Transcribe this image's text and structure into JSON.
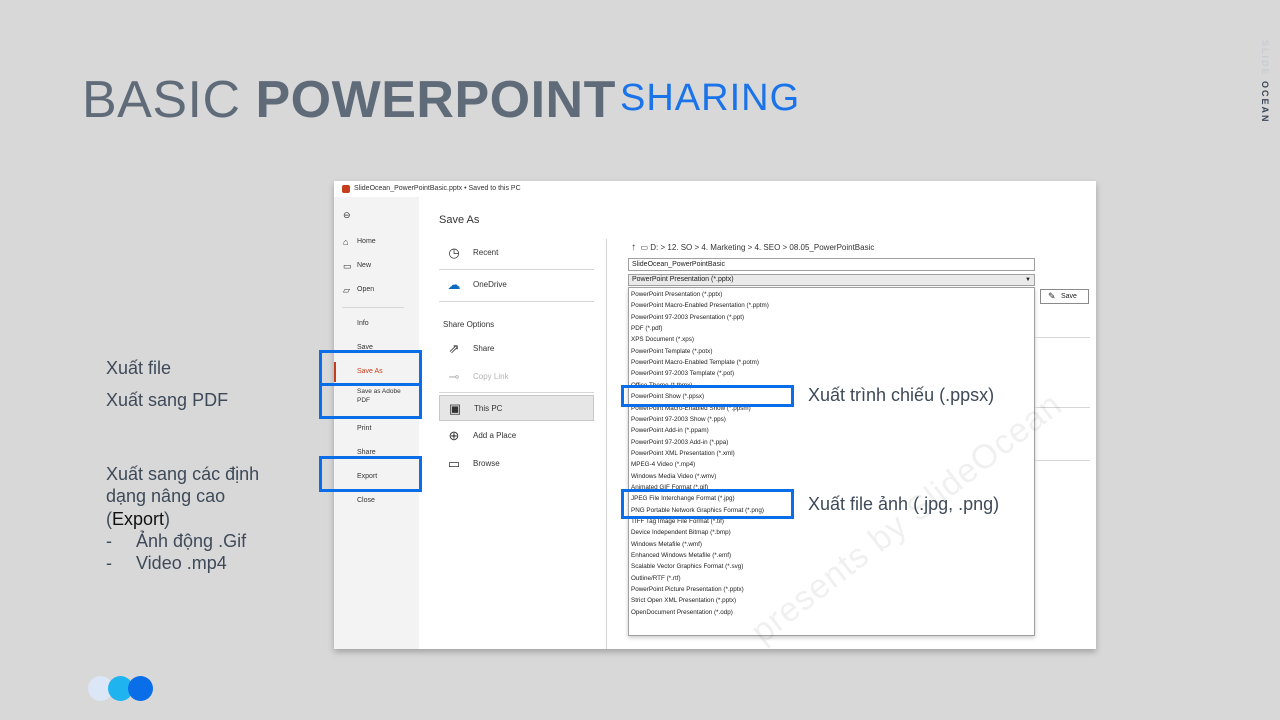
{
  "slide": {
    "title_light": "BASIC ",
    "title_bold": "POWERPOINT",
    "subtitle": "SHARING",
    "brand_line1": "SLIDE",
    "brand_line2": "OCEAN"
  },
  "left_notes": {
    "export_file": "Xuất file",
    "export_pdf": "Xuất sang PDF",
    "advanced_line1": "Xuất sang các định",
    "advanced_line2": "dạng nâng cao",
    "advanced_open": "(",
    "advanced_export": "Export",
    "advanced_close": ")",
    "bullet_dash": "-",
    "bullet1": "Ảnh động .Gif",
    "bullet2": "Video .mp4"
  },
  "window": {
    "title": "SlideOcean_PowerPointBasic.pptx • Saved to this PC"
  },
  "backstage_nav": {
    "home": "Home",
    "new": "New",
    "open": "Open",
    "info": "Info",
    "save": "Save",
    "save_as": "Save As",
    "save_as_pdf": "Save as Adobe PDF",
    "print": "Print",
    "share": "Share",
    "export": "Export",
    "close": "Close"
  },
  "save_as": {
    "title": "Save As",
    "recent": "Recent",
    "onedrive": "OneDrive",
    "share_options": "Share Options",
    "share": "Share",
    "copy_link": "Copy Link",
    "this_pc": "This PC",
    "add_place": "Add a Place",
    "browse": "Browse",
    "breadcrumb": "D: > 12. SO > 4. Marketing > 4. SEO > 08.05_PowerPointBasic",
    "file_name": "SlideOcean_PowerPointBasic",
    "file_type": "PowerPoint Presentation (*.pptx)",
    "save_button": "Save"
  },
  "file_types": [
    "PowerPoint Presentation (*.pptx)",
    "PowerPoint Macro-Enabled Presentation (*.pptm)",
    "PowerPoint 97-2003 Presentation (*.ppt)",
    "PDF (*.pdf)",
    "XPS Document (*.xps)",
    "PowerPoint Template (*.potx)",
    "PowerPoint Macro-Enabled Template (*.potm)",
    "PowerPoint 97-2003 Template (*.pot)",
    "Office Theme (*.thmx)",
    "PowerPoint Show (*.ppsx)",
    "PowerPoint Macro-Enabled Show (*.ppsm)",
    "PowerPoint 97-2003 Show (*.pps)",
    "PowerPoint Add-in (*.ppam)",
    "PowerPoint 97-2003 Add-in (*.ppa)",
    "PowerPoint XML Presentation (*.xml)",
    "MPEG-4 Video (*.mp4)",
    "Windows Media Video (*.wmv)",
    "Animated GIF Format (*.gif)",
    "JPEG File Interchange Format (*.jpg)",
    "PNG Portable Network Graphics Format (*.png)",
    "TIFF Tag Image File Format (*.tif)",
    "Device Independent Bitmap (*.bmp)",
    "Windows Metafile (*.wmf)",
    "Enhanced Windows Metafile (*.emf)",
    "Scalable Vector Graphics Format (*.svg)",
    "Outline/RTF (*.rtf)",
    "PowerPoint Picture Presentation (*.pptx)",
    "Strict Open XML Presentation (*.pptx)",
    "OpenDocument Presentation (*.odp)"
  ],
  "callouts": {
    "slideshow": "Xuất trình chiếu (.ppsx)",
    "image": "Xuất file ảnh (.jpg, .png)"
  },
  "watermark": "presents by SlideOcean",
  "colors": {
    "accent_blue": "#0a6ee8",
    "title_gray": "#5f6b78",
    "subtitle_blue": "#1a73e8",
    "ppt_orange": "#c43e1c"
  },
  "icons": [
    "back-arrow-icon",
    "home-icon",
    "new-icon",
    "open-icon",
    "clock-icon",
    "cloud-icon",
    "share-icon",
    "link-icon",
    "pc-icon",
    "globe-icon",
    "folder-icon",
    "up-arrow-icon",
    "save-icon"
  ]
}
